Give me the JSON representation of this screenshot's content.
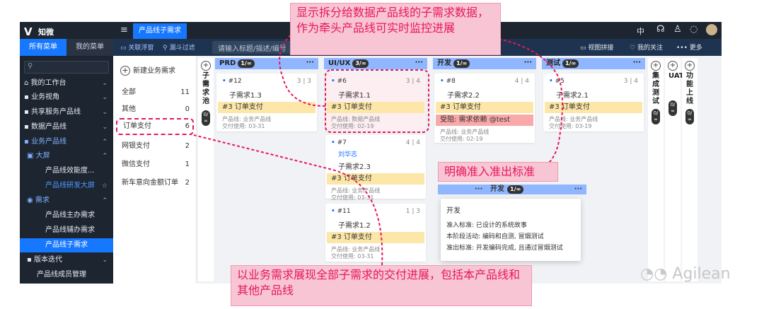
{
  "app": {
    "logo_text": "知微",
    "logo_mark": "V"
  },
  "sidebar": {
    "tabs": [
      "所有菜单",
      "我的菜单"
    ],
    "search_icon": "search-icon",
    "items": [
      {
        "label": "我的工作台",
        "chev": "⌄"
      },
      {
        "label": "业务视角",
        "chev": "⌄"
      },
      {
        "label": "共享服务产品线",
        "chev": "⌄"
      },
      {
        "label": "数据产品线",
        "chev": "⌄"
      },
      {
        "label": "业务产品线",
        "chev": "⌃"
      },
      {
        "label": "大屏",
        "chev": "⌃"
      },
      {
        "label": "产品线效能度..."
      },
      {
        "label": "产品线研发大屏",
        "star": "☆"
      },
      {
        "label": "需求",
        "chev": "⌃"
      },
      {
        "label": "产品线主办需求"
      },
      {
        "label": "产品线辅办需求"
      },
      {
        "label": "产品线子需求"
      },
      {
        "label": "版本迭代",
        "chev": "⌄"
      },
      {
        "label": "产品线成员管理"
      }
    ]
  },
  "topbar": {
    "tab": "产品线子需求",
    "lang": "中",
    "icons": [
      "headset-icon",
      "user-tree-icon",
      "chat-icon",
      "avatar"
    ]
  },
  "toolbar": {
    "link_float": "关联浮窗",
    "funnel": "漏斗过滤",
    "search_placeholder": "请输入标题/描述/编号",
    "view": "视图拼接",
    "follow": "我的关注",
    "more": "更多"
  },
  "requirements": {
    "new_label": "新建业务需求",
    "items": [
      {
        "label": "全部",
        "count": "11"
      },
      {
        "label": "其他",
        "count": "0"
      },
      {
        "label": "订单支付",
        "count": "6"
      },
      {
        "label": "网银支付",
        "count": "2"
      },
      {
        "label": "微信支付",
        "count": "1"
      },
      {
        "label": "新车意向金额订单",
        "count": "2"
      }
    ]
  },
  "board": {
    "pool": {
      "text": "子需求池",
      "pill": "0/∞"
    },
    "columns": [
      {
        "name": "PRD",
        "pill": "1/∞"
      },
      {
        "name": "UI/UX",
        "pill": "3/∞"
      },
      {
        "name": "开发",
        "pill": "1/∞"
      },
      {
        "name": "测试",
        "pill": "1/∞"
      }
    ],
    "side_columns": [
      {
        "text": "集成测试",
        "pill": "0/∞"
      },
      {
        "text": "UAT",
        "pill": "0/∞"
      },
      {
        "text": "功能上线",
        "pill": "0/∞"
      }
    ],
    "cards": [
      {
        "num": "#12",
        "ratio": "3 | 3",
        "title": "子需求1.3",
        "tag": "#3 订单支付",
        "line": "产品线: 业务产品线",
        "date": "交付使用: 03-31"
      },
      {
        "num": "#6",
        "ratio": "3 | 4",
        "title": "子需求1.1",
        "tag": "#3 订单支付",
        "line": "产品线: 数据产品线",
        "date": "交付使用: 02-19"
      },
      {
        "num": "#7",
        "ratio": "4 | 4",
        "who": "刘华志",
        "title": "子需求2.3",
        "tag": "#3 订单支付",
        "line": "产品线: 业务产品线",
        "date": "交付使用: 03-31"
      },
      {
        "num": "#11",
        "ratio": "1 | 3",
        "title": "子需求1.2",
        "tag": "#3 订单支付",
        "line": "产品线: 业务产品线",
        "date": "交付使用: 03-31"
      },
      {
        "num": "#8",
        "ratio": "4 | 4",
        "title": "子需求2.2",
        "tag": "#3 订单支付",
        "block": "受阻: 需求依赖 @test",
        "line": "产品线: 业务产品线",
        "date": "交付使用: 02-19"
      },
      {
        "num": "#5",
        "ratio": "3 | 4",
        "title": "子需求2.1",
        "tag": "#3 订单支付",
        "line": "产品线: 业务产品线",
        "date": "交付使用: 03-19"
      }
    ]
  },
  "popup": {
    "col_name": "开发",
    "pill": "1/∞",
    "title": "开发",
    "entry": "准入标准: 已设计的系统故事",
    "activity": "本阶段活动: 编码和自测, 冒烟测试",
    "exit": "准出标准: 开发编码完成, 且通过冒烟测试"
  },
  "callouts": {
    "top": "显示拆分给数据产品线的子需求数据，作为牵头产品线可实时监控进展",
    "mid": "明确准入准出标准",
    "bottom": "以业务需求展现全部子需求的交付进展，包括本产品线和其他产品线"
  },
  "watermark": "Agilean",
  "colors": {
    "accent": "#1677ff",
    "callout_text": "#e8175d",
    "column_header": "#8fb6ff",
    "tag": "#fce7a8",
    "blocked": "#f9a9a9"
  }
}
